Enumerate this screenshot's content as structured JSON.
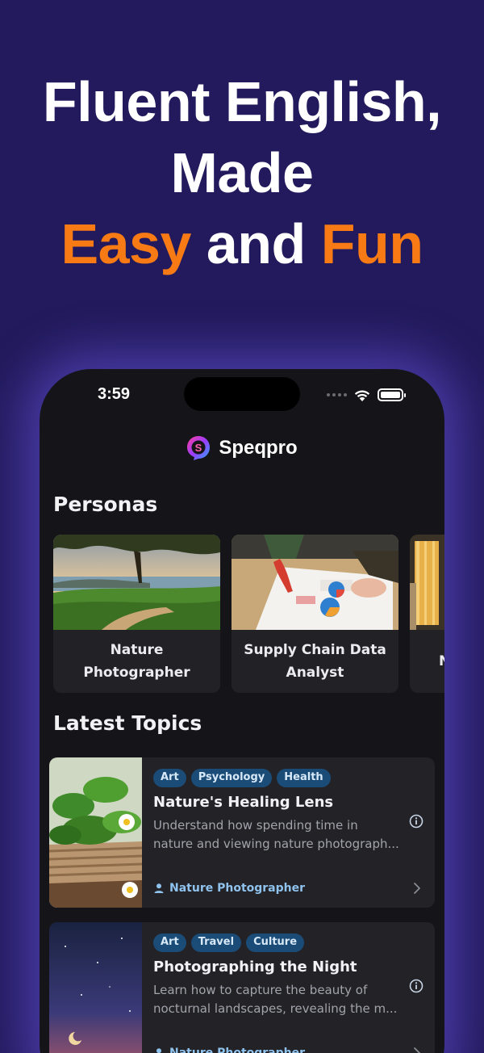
{
  "headline": {
    "line1": "Fluent English,",
    "line2": "Made",
    "accent1": "Easy",
    "middle": " and ",
    "accent2": "Fun"
  },
  "status_bar": {
    "time": "3:59"
  },
  "app": {
    "name": "Speqpro"
  },
  "personas": {
    "title": "Personas",
    "items": [
      {
        "label_line1": "Nature",
        "label_line2": "Photographer"
      },
      {
        "label_line1": "Supply Chain Data",
        "label_line2": "Analyst"
      },
      {
        "label_line1": "",
        "label_line2": "N"
      }
    ]
  },
  "topics": {
    "title": "Latest Topics",
    "items": [
      {
        "tags": [
          "Art",
          "Psychology",
          "Health"
        ],
        "title": "Nature's Healing Lens",
        "desc_line1": "Understand how spending time in",
        "desc_line2": "nature and viewing nature photograph...",
        "persona": "Nature Photographer"
      },
      {
        "tags": [
          "Art",
          "Travel",
          "Culture"
        ],
        "title": "Photographing the Night",
        "desc_line1": "Learn how to capture the beauty of",
        "desc_line2": "nocturnal landscapes, revealing the m...",
        "persona": "Nature Photographer"
      }
    ]
  },
  "colors": {
    "background": "#221a5c",
    "accent": "#f77a14",
    "tag_bg": "#1b4c78",
    "link": "#8fc3ee"
  }
}
